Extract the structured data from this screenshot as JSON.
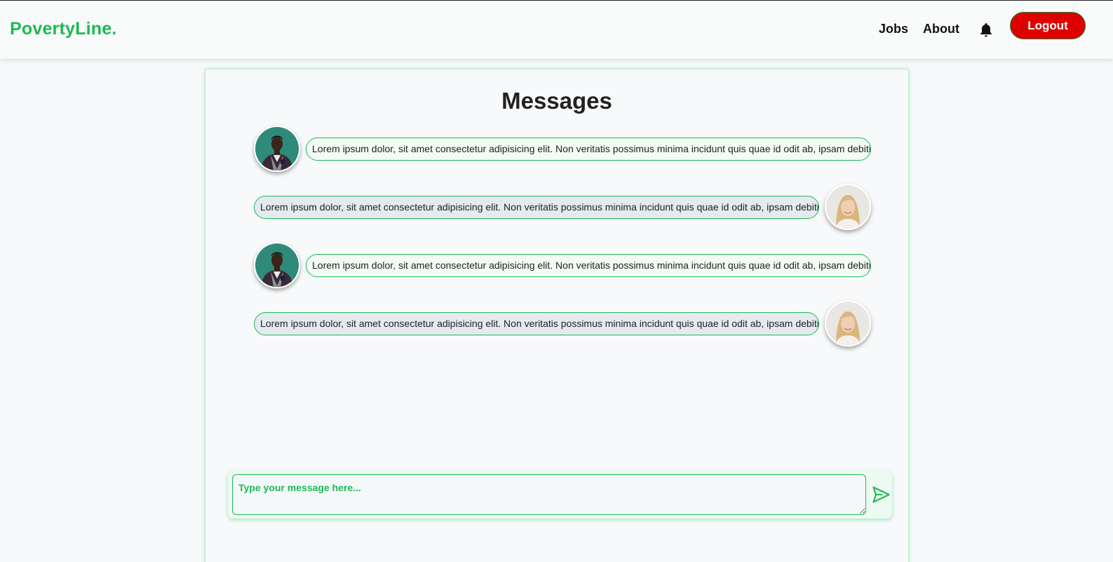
{
  "nav": {
    "brand": "PovertyLine.",
    "links": [
      {
        "label": "Jobs"
      },
      {
        "label": "About"
      }
    ],
    "bell_icon": "bell-icon",
    "logout_label": "Logout"
  },
  "colors": {
    "brand": "#1db954",
    "logout": "#e00000",
    "incoming_bubble": "#f3fbf5",
    "outgoing_bubble": "#e4eaef"
  },
  "chat": {
    "title": "Messages",
    "messages": [
      {
        "from": "other",
        "avatar": "man-avatar",
        "text": "Lorem ipsum dolor, sit amet consectetur adipisicing elit. Non veritatis possimus minima incidunt quis quae id odit ab, ipsam debitis"
      },
      {
        "from": "me",
        "avatar": "woman-avatar",
        "text": "Lorem ipsum dolor, sit amet consectetur adipisicing elit. Non veritatis possimus minima incidunt quis quae id odit ab, ipsam debitis"
      },
      {
        "from": "other",
        "avatar": "man-avatar",
        "text": "Lorem ipsum dolor, sit amet consectetur adipisicing elit. Non veritatis possimus minima incidunt quis quae id odit ab, ipsam debitis"
      },
      {
        "from": "me",
        "avatar": "woman-avatar",
        "text": "Lorem ipsum dolor, sit amet consectetur adipisicing elit. Non veritatis possimus minima incidunt quis quae id odit ab, ipsam debitis"
      }
    ],
    "composer": {
      "placeholder": "Type your message here...",
      "value": "",
      "send_icon": "send-icon"
    }
  }
}
